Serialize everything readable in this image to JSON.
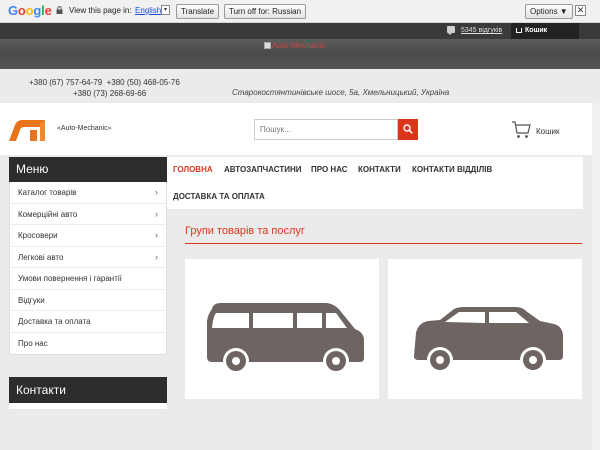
{
  "translate_bar": {
    "logo": "Google",
    "message": "View this page in:",
    "language": "English",
    "translate_button": "Translate",
    "turn_off_button": "Turn off for: Russian",
    "options_button": "Options ▼",
    "close": "✕"
  },
  "topbar": {
    "reviews_count": "5345 відгуків",
    "cart_label": "Кошик"
  },
  "banner": {
    "image_alt": "Auto-Mechanic"
  },
  "contacts": {
    "phones_line1": "+380 (67) 757-64-79  +380 (50) 468-05-76",
    "phones_line2": "+380 (73) 268-69-66",
    "address": "Старокостянтинівське шосе, 5а, Хмельницький, Україна"
  },
  "header": {
    "logo_text": "«Auto-Mechanic»",
    "search_placeholder": "Пошук...",
    "cart_label": "Кошик"
  },
  "sidebar": {
    "menu_title": "Меню",
    "items": [
      {
        "label": "Каталог товарів",
        "has_submenu": true
      },
      {
        "label": "Комерційні авто",
        "has_submenu": true
      },
      {
        "label": "Кросовери",
        "has_submenu": true
      },
      {
        "label": "Легкові авто",
        "has_submenu": true
      },
      {
        "label": "Умови повернення і гарантії",
        "has_submenu": false
      },
      {
        "label": "Відгуки",
        "has_submenu": false
      },
      {
        "label": "Доставка та оплата",
        "has_submenu": false
      },
      {
        "label": "Про нас",
        "has_submenu": false
      }
    ],
    "contacts_title": "Контакти",
    "chevron": "›"
  },
  "nav": {
    "items": [
      "ГОЛОВНА",
      "АВТОЗАПЧАСТИНИ",
      "ПРО НАС",
      "КОНТАКТИ",
      "КОНТАКТИ ВІДДІЛІВ",
      "ДОСТАВКА ТА ОПЛАТА"
    ],
    "active_index": 0
  },
  "main": {
    "section_title": "Групи товарів та послуг",
    "cards": [
      {
        "icon": "van-icon"
      },
      {
        "icon": "crossover-car-icon"
      }
    ]
  },
  "colors": {
    "accent": "#d9361c",
    "dark": "#2d2d2d",
    "vehicle": "#6e6562"
  }
}
